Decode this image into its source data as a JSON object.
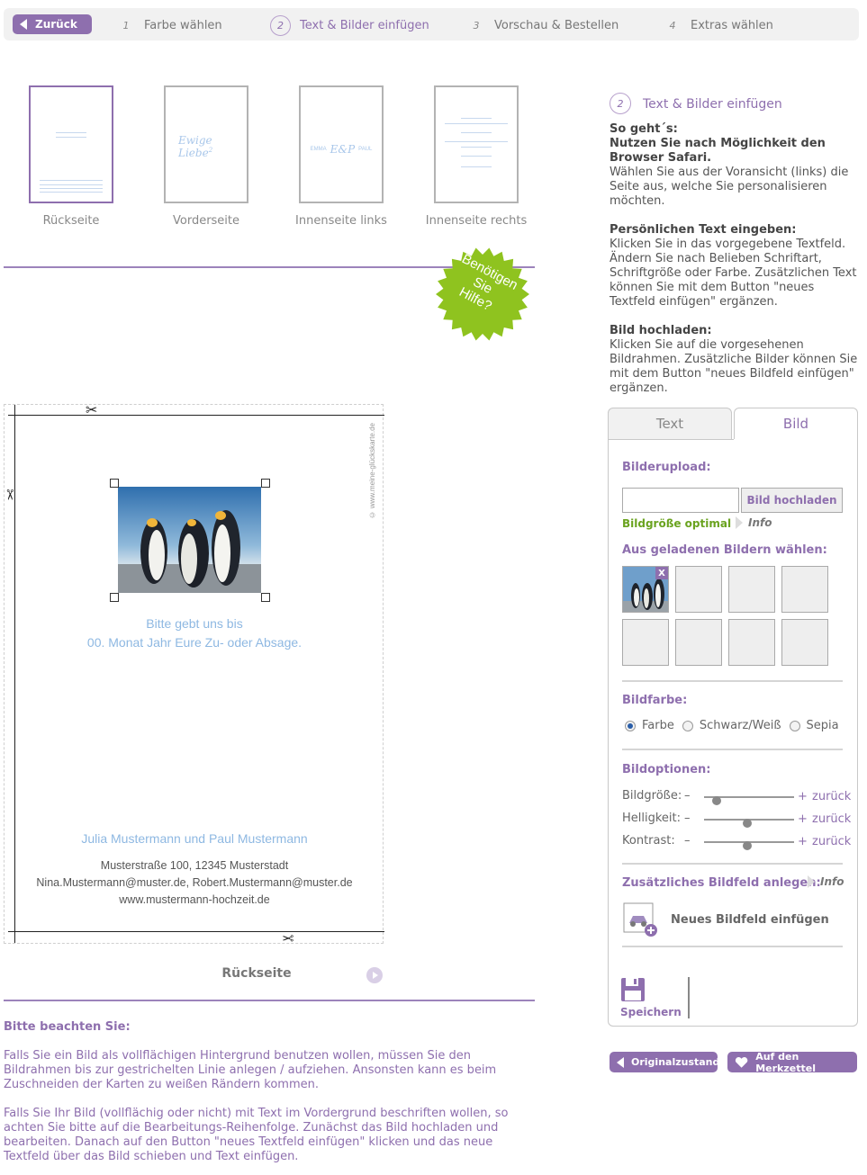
{
  "nav": {
    "back_label": "Zurück",
    "steps": [
      {
        "num": "1",
        "label": "Farbe wählen"
      },
      {
        "num": "2",
        "label": "Text & Bilder einfügen"
      },
      {
        "num": "3",
        "label": "Vorschau & Bestellen"
      },
      {
        "num": "4",
        "label": "Extras wählen"
      }
    ]
  },
  "thumbnails": [
    {
      "label": "Rückseite"
    },
    {
      "label": "Vorderseite",
      "script_text": "Ewige Liebe",
      "superscript": "2"
    },
    {
      "label": "Innenseite links",
      "left_name": "EMMA",
      "right_name": "PAUL",
      "monogram": "E&P"
    },
    {
      "label": "Innenseite rechts"
    }
  ],
  "help_badge": {
    "line1": "Benötigen",
    "line2": "Sie",
    "line3": "Hilfe?",
    "color": "#8fc31f"
  },
  "card": {
    "side_url": "© www.meine-glückskarte.de",
    "rsvp_line1": "Bitte gebt uns bis",
    "rsvp_line2": "00. Monat Jahr Eure Zu- oder Absage.",
    "names": "Julia Mustermann und Paul Mustermann",
    "address": "Musterstraße 100, 12345 Musterstadt",
    "emails": "Nina.Mustermann@muster.de, Robert.Mustermann@muster.de",
    "website": "www.mustermann-hochzeit.de",
    "page_name": "Rückseite"
  },
  "notes": {
    "title": "Bitte beachten Sie:",
    "p1": "Falls Sie ein Bild als vollflächigen Hintergrund benutzen wollen, müssen Sie den Bildrahmen bis zur gestrichelten Linie anlegen / aufziehen. Ansonsten kann es beim Zuschneiden der Karten zu weißen Rändern kommen.",
    "p2": "Falls Sie Ihr Bild (vollflächig oder nicht) mit Text im Vordergrund beschriften wollen, so achten Sie bitte auf die Bearbeitungs-Reihenfolge. Zunächst das Bild hochladen und bearbeiten. Danach auf den Button \"neues Textfeld einfügen\" klicken und das neue Textfeld über das Bild schieben und Text einfügen."
  },
  "sidebar": {
    "step_num": "2",
    "step_title": "Text & Bilder einfügen",
    "howto_title": "So geht´s:",
    "howto_bold": "Nutzen Sie nach Möglichkeit den Browser Safari.",
    "howto_text": "Wählen Sie aus der Voransicht (links) die Seite aus, welche Sie personalisieren möchten.",
    "text_title": "Persönlichen Text eingeben:",
    "text_body": "Klicken Sie in das vorgegebene Textfeld. Ändern Sie nach Belieben Schriftart, Schriftgröße oder Farbe. Zusätzlichen Text können Sie mit dem Button \"neues Textfeld einfügen\" ergänzen.",
    "image_title": "Bild hochladen:",
    "image_body": "Klicken Sie auf die vorgesehenen Bildrahmen. Zusätzliche Bilder können Sie mit dem Button \"neues Bildfeld einfügen\" ergänzen."
  },
  "panel": {
    "tab_text": "Text",
    "tab_image": "Bild",
    "upload_title": "Bilderupload:",
    "upload_value": "",
    "upload_button": "Bild hochladen",
    "optimal_label": "Bildgröße optimal",
    "info_label": "Info",
    "choose_title": "Aus geladenen Bildern wählen:",
    "delete_label": "X",
    "color_title": "Bildfarbe:",
    "color_options": [
      "Farbe",
      "Schwarz/Weiß",
      "Sepia"
    ],
    "color_selected": "Farbe",
    "options_title": "Bildoptionen:",
    "options": [
      {
        "label": "Bildgröße:",
        "minus": "–",
        "plus": "+",
        "reset": "zurück",
        "level": 0.14
      },
      {
        "label": "Helligkeit:",
        "minus": "–",
        "plus": "+",
        "reset": "zurück",
        "level": 0.48
      },
      {
        "label": "Kontrast:",
        "minus": "–",
        "plus": "+",
        "reset": "zurück",
        "level": 0.48
      }
    ],
    "extra_title": "Zusätzliches Bildfeld anlegen:",
    "extra_info": "Info",
    "new_field_label": "Neues Bildfeld einfügen",
    "save_label": "Speichern"
  },
  "bottom_buttons": {
    "reset_label": "Originalzustand",
    "wishlist_label": "Auf den Merkzettel"
  },
  "colors": {
    "accent": "#8e6fae",
    "green": "#6aa31f",
    "card_text": "#8eb8e2"
  }
}
